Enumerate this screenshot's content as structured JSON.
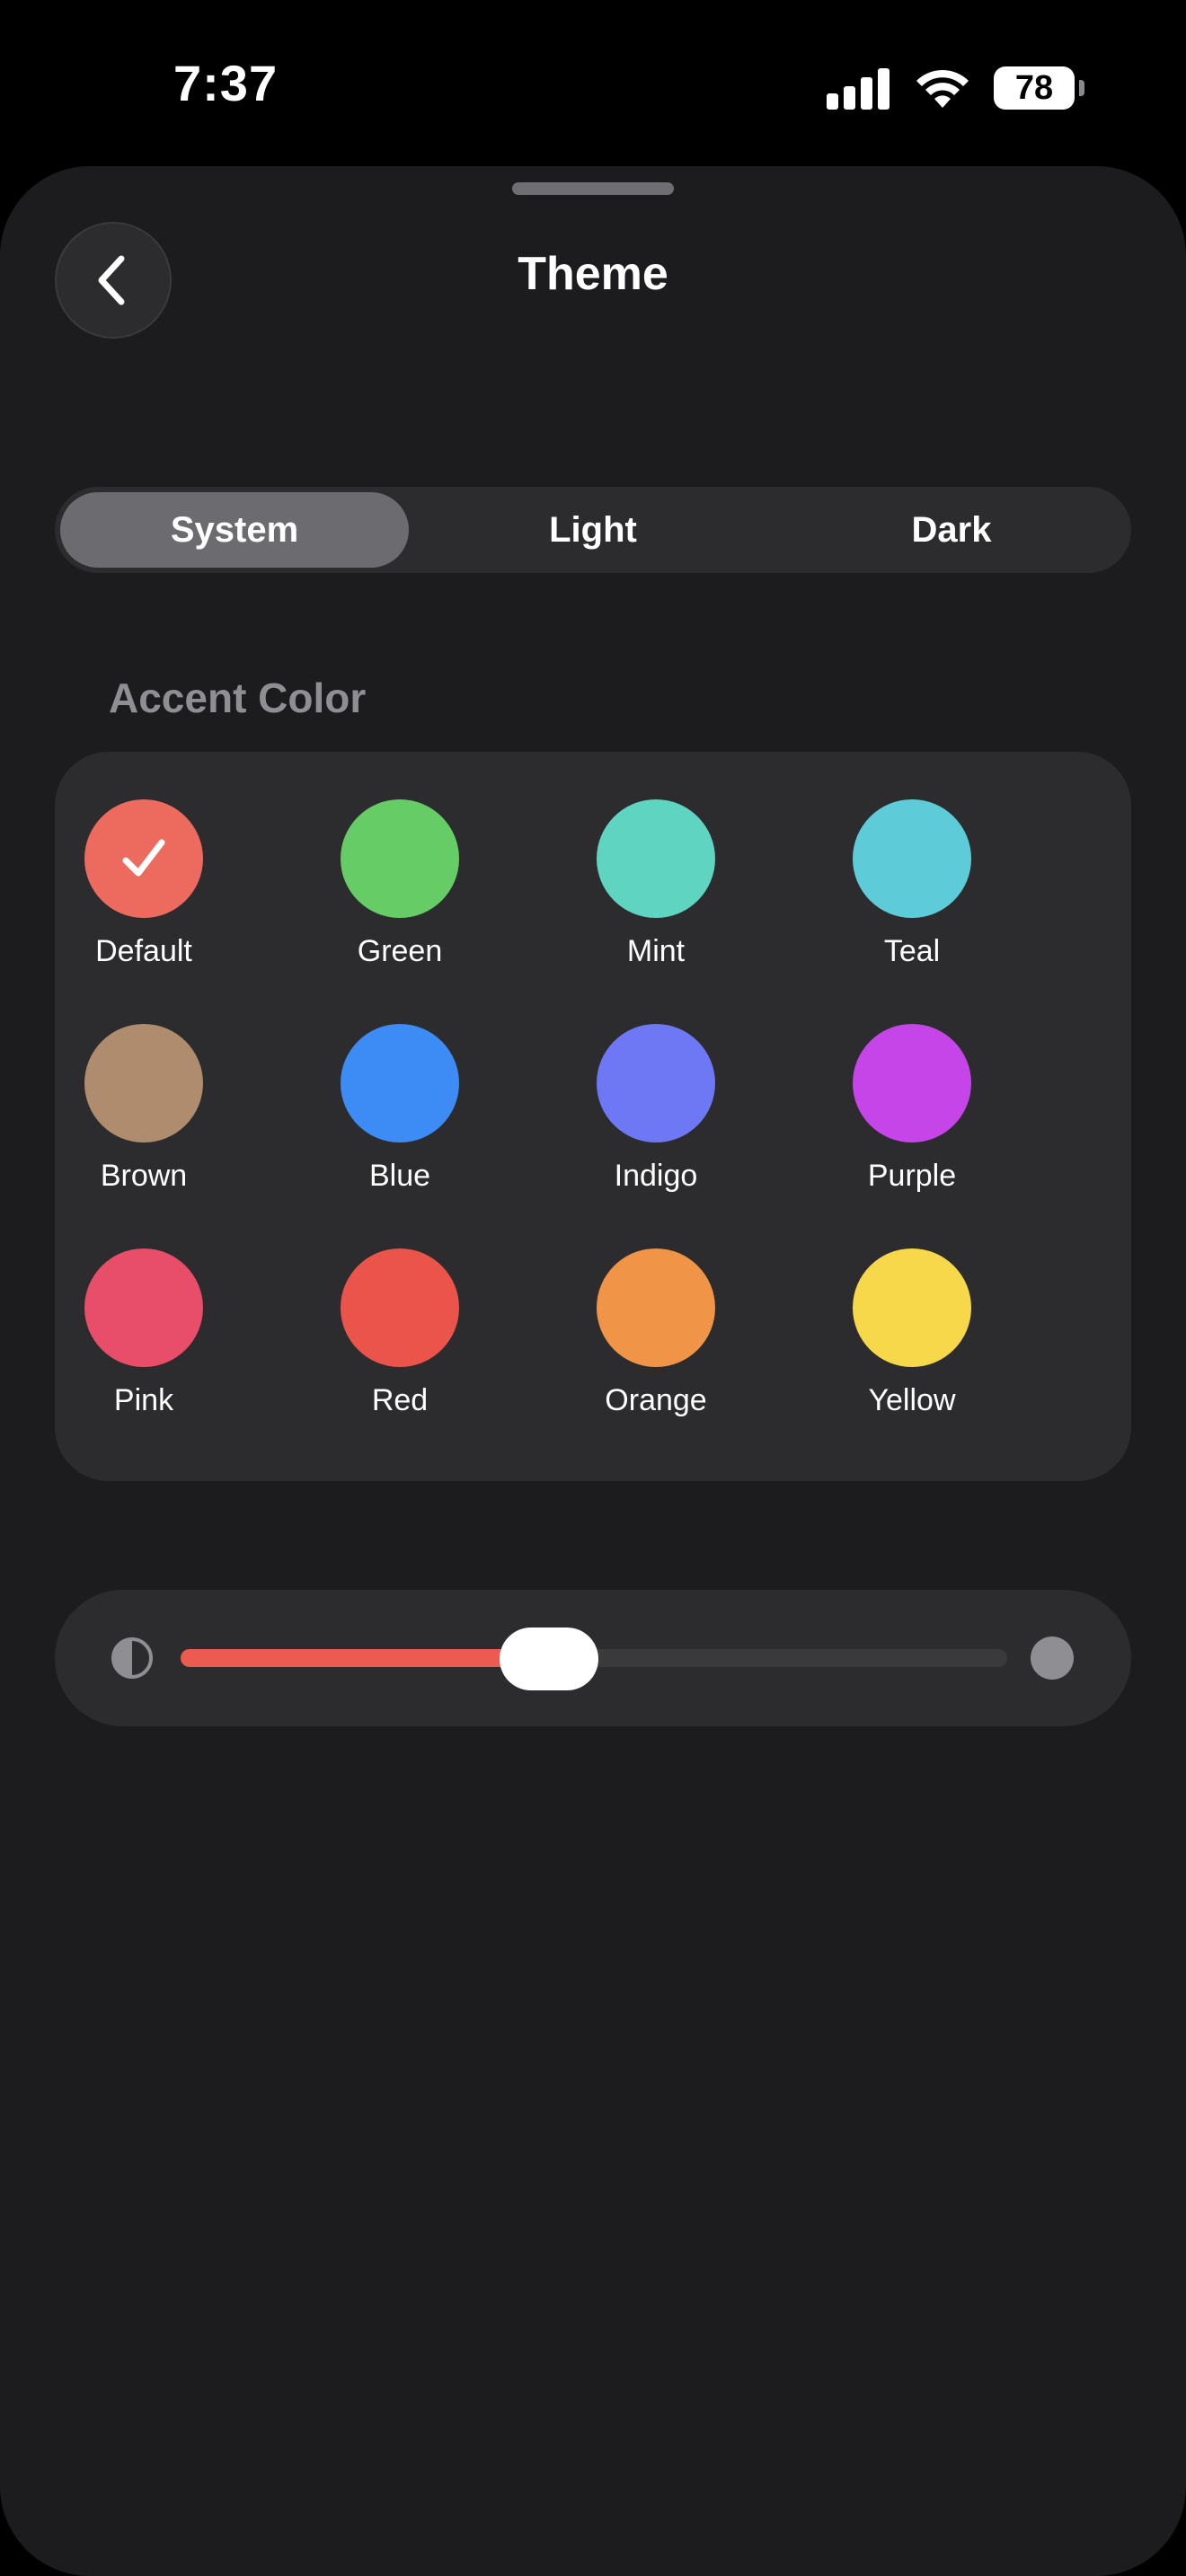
{
  "status_bar": {
    "time": "7:37",
    "battery": "78",
    "icons": [
      "cellular-signal-icon",
      "wifi-icon",
      "battery-icon"
    ]
  },
  "header": {
    "title": "Theme",
    "back_icon": "chevron-left-icon"
  },
  "appearance_tabs": {
    "selected": "System",
    "items": [
      {
        "label": "System"
      },
      {
        "label": "Light"
      },
      {
        "label": "Dark"
      }
    ]
  },
  "accent": {
    "section_label": "Accent Color",
    "selected": "Default",
    "colors": [
      {
        "label": "Default",
        "color": "#ec6a5e"
      },
      {
        "label": "Green",
        "color": "#66cc66"
      },
      {
        "label": "Mint",
        "color": "#5fd4c0"
      },
      {
        "label": "Teal",
        "color": "#5ecbd9"
      },
      {
        "label": "Brown",
        "color": "#b08c6e"
      },
      {
        "label": "Blue",
        "color": "#3d8bf5"
      },
      {
        "label": "Indigo",
        "color": "#6e78f5"
      },
      {
        "label": "Purple",
        "color": "#c545e8"
      },
      {
        "label": "Pink",
        "color": "#e84d69"
      },
      {
        "label": "Red",
        "color": "#ea544b"
      },
      {
        "label": "Orange",
        "color": "#f09447"
      },
      {
        "label": "Yellow",
        "color": "#f7d84a"
      }
    ]
  },
  "contrast_slider": {
    "value": 0.5,
    "fill_color": "#eb5b4f",
    "start_icon": "contrast-icon",
    "end_icon": "circle-icon"
  }
}
